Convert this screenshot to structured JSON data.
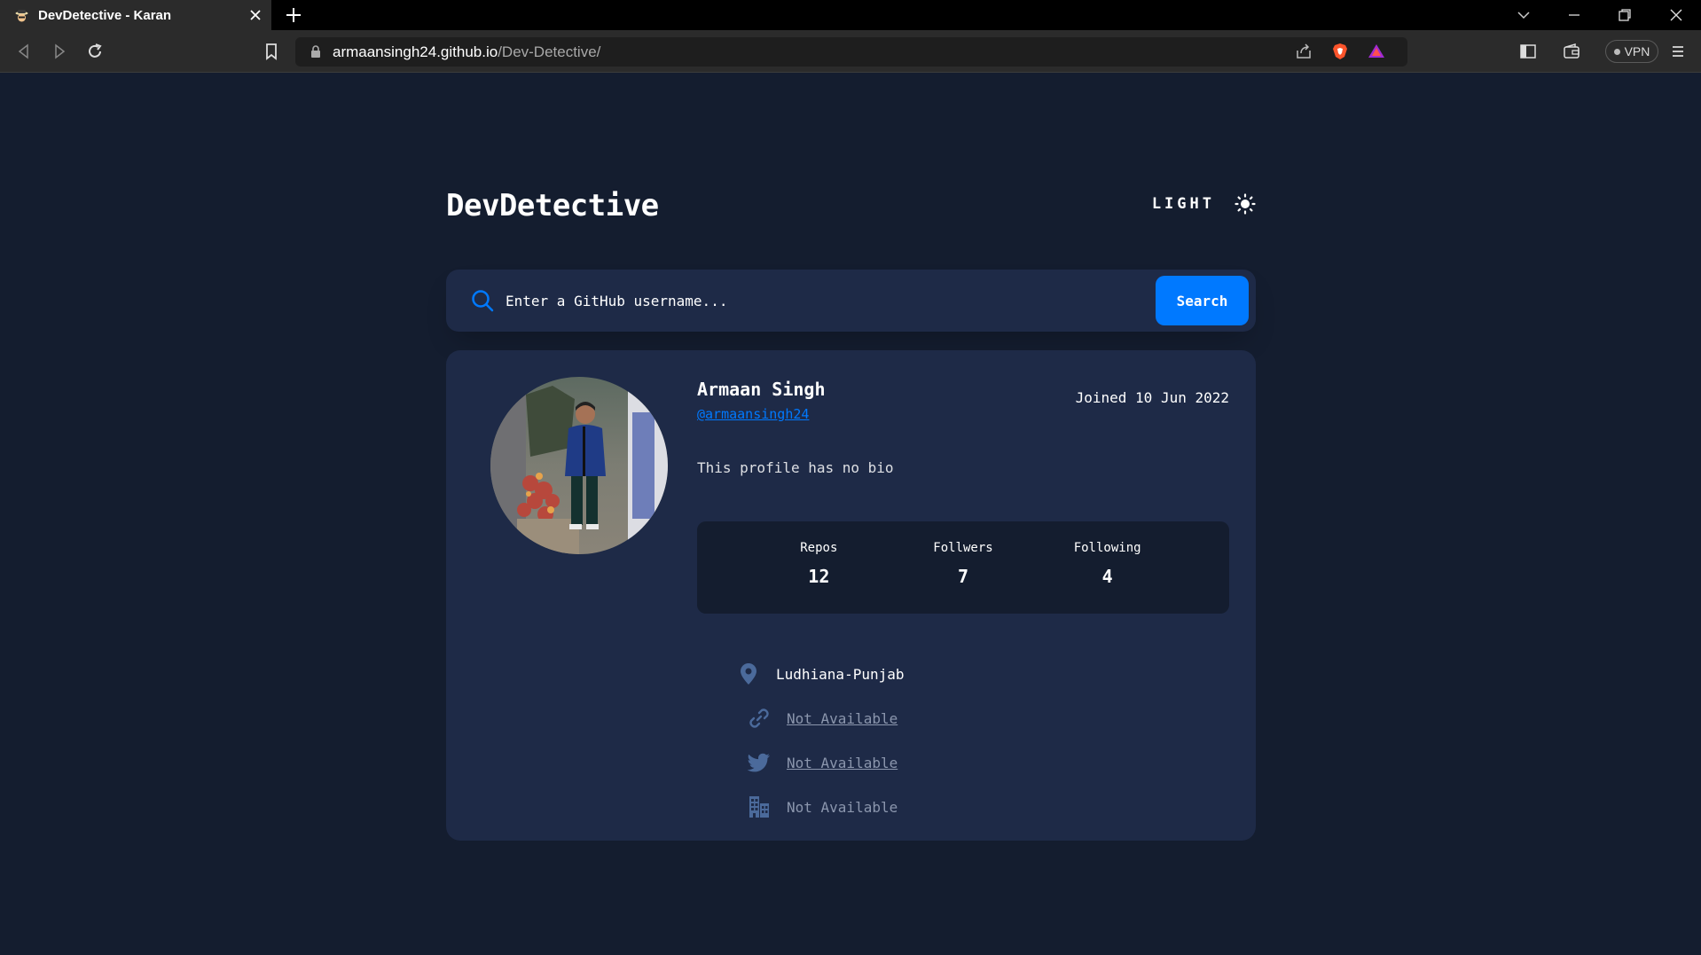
{
  "browser": {
    "tab_title": "DevDetective - Karan",
    "url_host": "armaansingh24.github.io",
    "url_path": "/Dev-Detective/",
    "vpn_label": "VPN"
  },
  "app": {
    "logo": "DevDetective",
    "theme_label": "LIGHT",
    "search": {
      "placeholder": "Enter a GitHub username...",
      "button_label": "Search"
    },
    "profile": {
      "name": "Armaan Singh",
      "handle": "@armaansingh24",
      "joined": "Joined 10 Jun 2022",
      "bio": "This profile has no bio",
      "stats": [
        {
          "label": "Repos",
          "value": "12"
        },
        {
          "label": "Follwers",
          "value": "7"
        },
        {
          "label": "Following",
          "value": "4"
        }
      ],
      "location": "Ludhiana-Punjab",
      "website": "Not Available",
      "twitter": "Not Available",
      "company": "Not Available"
    },
    "colors": {
      "background": "#141d2f",
      "card": "#1e2a47",
      "accent": "#0079ff"
    }
  }
}
